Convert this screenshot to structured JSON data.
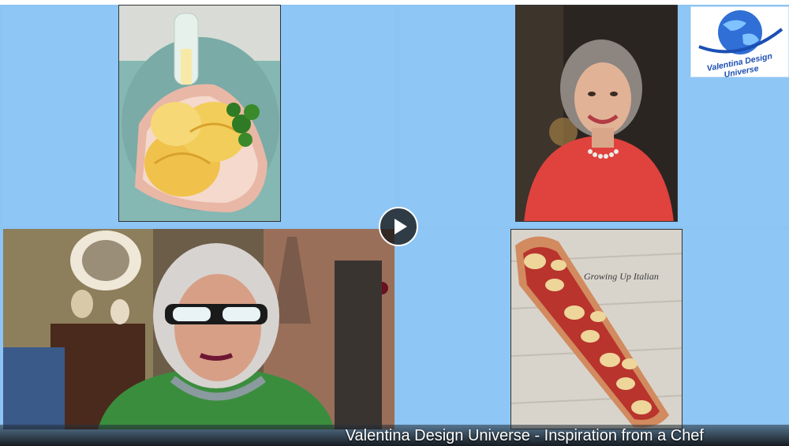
{
  "caption": {
    "title": "Valentina Design Universe - Inspiration from a Chef"
  },
  "logo": {
    "text": "Valentina Design Universe"
  },
  "tiles": {
    "pie_watermark": "Growing Up Italian"
  },
  "controls": {
    "play_icon": "play-icon"
  },
  "colors": {
    "background": "#8cc4f4",
    "caption_text": "#ffffff",
    "logo_blue": "#1c4fb3"
  }
}
